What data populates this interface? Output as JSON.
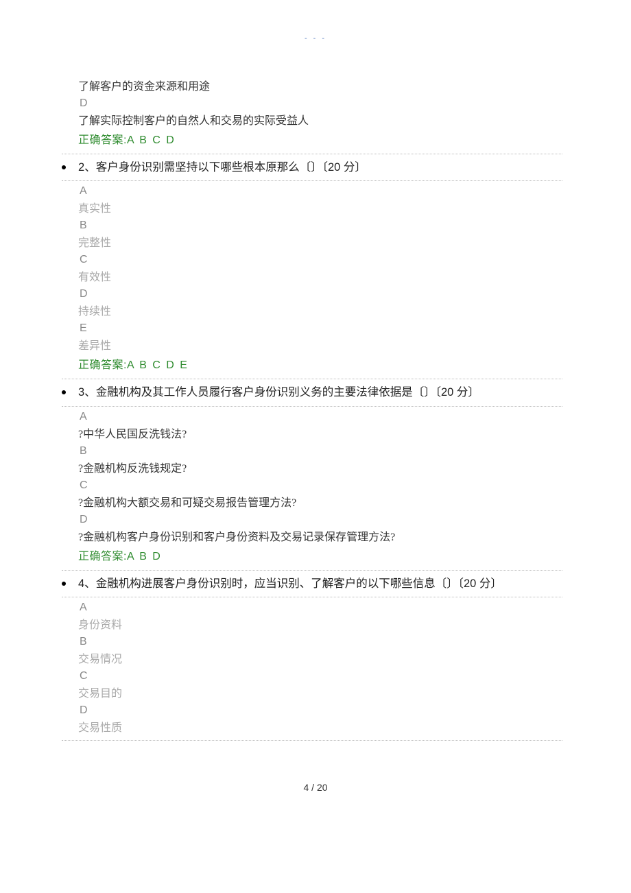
{
  "header_marks": "- - -",
  "q1_continuation": {
    "option_c_text": "了解客户的资金来源和用途",
    "option_d_letter": "D",
    "option_d_text": "了解实际控制客户的自然人和交易的实际受益人",
    "answer_label": "正确答案:",
    "answer_value": "A B C D"
  },
  "questions": [
    {
      "number": "2、",
      "title": "客户身份识别需坚持以下哪些根本原那么〔〕〔20 分〕",
      "options": [
        {
          "letter": "A",
          "text": "真实性"
        },
        {
          "letter": "B",
          "text": "完整性"
        },
        {
          "letter": "C",
          "text": "有效性"
        },
        {
          "letter": "D",
          "text": "持续性"
        },
        {
          "letter": "E",
          "text": "差异性"
        }
      ],
      "answer_label": "正确答案:",
      "answer_value": "A B C D E"
    },
    {
      "number": "3、",
      "title": "金融机构及其工作人员履行客户身份识别义务的主要法律依据是〔〕〔20 分〕",
      "options": [
        {
          "letter": "A",
          "text": "?中华人民国反洗钱法?"
        },
        {
          "letter": "B",
          "text": "?金融机构反洗钱规定?"
        },
        {
          "letter": "C",
          "text": "?金融机构大额交易和可疑交易报告管理方法?"
        },
        {
          "letter": "D",
          "text": "?金融机构客户身份识别和客户身份资料及交易记录保存管理方法?"
        }
      ],
      "answer_label": "正确答案:",
      "answer_value": "A B D"
    },
    {
      "number": "4、",
      "title": "金融机构进展客户身份识别时，应当识别、了解客户的以下哪些信息〔〕〔20 分〕",
      "options": [
        {
          "letter": "A",
          "text": "身份资料"
        },
        {
          "letter": "B",
          "text": "交易情况"
        },
        {
          "letter": "C",
          "text": "交易目的"
        },
        {
          "letter": "D",
          "text": "交易性质"
        }
      ],
      "answer_label": "",
      "answer_value": ""
    }
  ],
  "footer": "4  /  20"
}
